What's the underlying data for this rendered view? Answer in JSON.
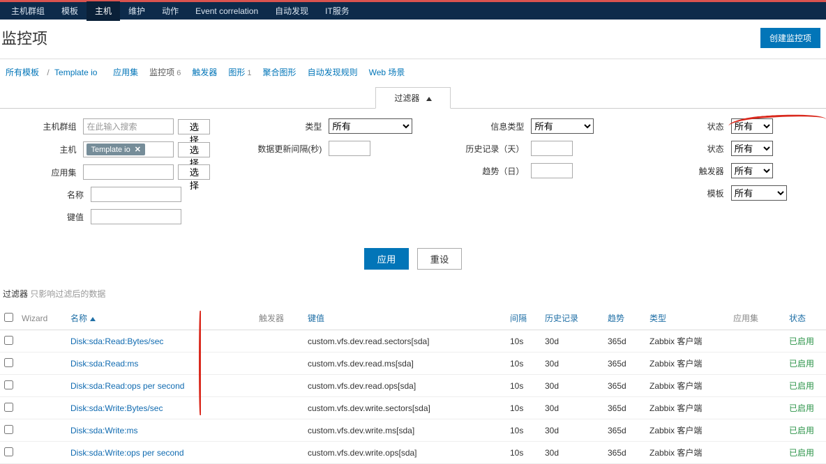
{
  "nav": {
    "items": [
      "主机群组",
      "模板",
      "主机",
      "维护",
      "动作",
      "Event correlation",
      "自动发现",
      "IT服务"
    ],
    "active": 2
  },
  "page_title": "监控项",
  "create_btn": "创建监控项",
  "crumb": {
    "all_templates": "所有模板",
    "template": "Template io",
    "items": [
      {
        "label": "应用集",
        "count": ""
      },
      {
        "label": "监控项",
        "count": "6",
        "active": true
      },
      {
        "label": "触发器",
        "count": ""
      },
      {
        "label": "图形",
        "count": "1"
      },
      {
        "label": "聚合图形",
        "count": ""
      },
      {
        "label": "自动发现规则",
        "count": ""
      },
      {
        "label": "Web 场景",
        "count": ""
      }
    ]
  },
  "filter": {
    "tab_label": "过滤器",
    "labels": {
      "hostgroup": "主机群组",
      "host": "主机",
      "application": "应用集",
      "name": "名称",
      "key": "键值",
      "type": "类型",
      "interval": "数据更新间隔(秒)",
      "infotype": "信息类型",
      "history": "历史记录（天）",
      "trend": "趋势（日）",
      "status": "状态",
      "state": "状态",
      "trigger": "触发器",
      "template": "模板"
    },
    "hostgroup_placeholder": "在此输入搜索",
    "host_tag": "Template io",
    "select_btn": "选择",
    "opt_all": "所有",
    "apply": "应用",
    "reset": "重设"
  },
  "hint": {
    "a": "过滤器",
    "b": "只影响过滤后的数据"
  },
  "table": {
    "headers": {
      "wizard": "Wizard",
      "name": "名称",
      "triggers": "触发器",
      "key": "键值",
      "interval": "间隔",
      "history": "历史记录",
      "trend": "趋势",
      "type": "类型",
      "app": "应用集",
      "status": "状态"
    },
    "rows": [
      {
        "name": "Disk:sda:Read:Bytes/sec",
        "key": "custom.vfs.dev.read.sectors[sda]",
        "interval": "10s",
        "history": "30d",
        "trend": "365d",
        "type": "Zabbix 客户端",
        "status": "已启用"
      },
      {
        "name": "Disk:sda:Read:ms",
        "key": "custom.vfs.dev.read.ms[sda]",
        "interval": "10s",
        "history": "30d",
        "trend": "365d",
        "type": "Zabbix 客户端",
        "status": "已启用"
      },
      {
        "name": "Disk:sda:Read:ops per second",
        "key": "custom.vfs.dev.read.ops[sda]",
        "interval": "10s",
        "history": "30d",
        "trend": "365d",
        "type": "Zabbix 客户端",
        "status": "已启用"
      },
      {
        "name": "Disk:sda:Write:Bytes/sec",
        "key": "custom.vfs.dev.write.sectors[sda]",
        "interval": "10s",
        "history": "30d",
        "trend": "365d",
        "type": "Zabbix 客户端",
        "status": "已启用"
      },
      {
        "name": "Disk:sda:Write:ms",
        "key": "custom.vfs.dev.write.ms[sda]",
        "interval": "10s",
        "history": "30d",
        "trend": "365d",
        "type": "Zabbix 客户端",
        "status": "已启用"
      },
      {
        "name": "Disk:sda:Write:ops per second",
        "key": "custom.vfs.dev.write.ops[sda]",
        "interval": "10s",
        "history": "30d",
        "trend": "365d",
        "type": "Zabbix 客户端",
        "status": "已启用"
      }
    ]
  }
}
